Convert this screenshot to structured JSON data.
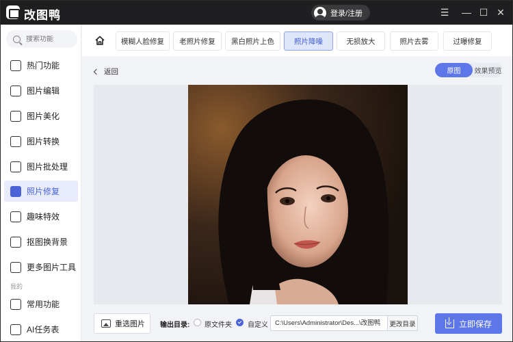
{
  "app": {
    "title": "改图鸭",
    "login_label": "登录/注册"
  },
  "window_controls": {
    "menu": "☰",
    "minimize": "—",
    "maximize": "☐",
    "close": "✕"
  },
  "sidebar": {
    "search_placeholder": "搜索功能",
    "items": [
      {
        "label": "热门功能",
        "icon": "fire-icon"
      },
      {
        "label": "图片编辑",
        "icon": "image-edit-icon"
      },
      {
        "label": "图片美化",
        "icon": "image-beautify-icon"
      },
      {
        "label": "图片转换",
        "icon": "image-convert-icon"
      },
      {
        "label": "图片批处理",
        "icon": "batch-icon"
      },
      {
        "label": "照片修复",
        "icon": "photo-repair-icon"
      },
      {
        "label": "趣味特效",
        "icon": "magic-icon"
      },
      {
        "label": "抠图换背景",
        "icon": "cutout-icon"
      },
      {
        "label": "更多图片工具",
        "icon": "toolbox-icon"
      }
    ],
    "section_label": "我的",
    "my_items": [
      {
        "label": "常用功能",
        "icon": "grid-icon"
      },
      {
        "label": "AI任务表",
        "icon": "task-list-icon"
      }
    ],
    "active_index": 5
  },
  "tool_tabs": {
    "items": [
      "模糊人脸修复",
      "老照片修复",
      "黑白照片上色",
      "照片降噪",
      "无损放大",
      "照片去雾",
      "过曝修复"
    ],
    "active_index": 3
  },
  "main": {
    "back_label": "返回",
    "toggle_original": "原图",
    "toggle_preview": "效果预览"
  },
  "bottom": {
    "reselect_label": "重选图片",
    "output_label": "输出目录:",
    "option_original": "原文件夹",
    "option_custom": "自定义",
    "path_value": "C:\\Users\\Administrator\\Des...\\改图鸭",
    "change_dir_label": "更改目录",
    "save_label": "立即保存"
  },
  "colors": {
    "accent": "#5e77e8",
    "titlebar": "#1f1f21",
    "active_nav_bg": "#e7ebfb"
  }
}
